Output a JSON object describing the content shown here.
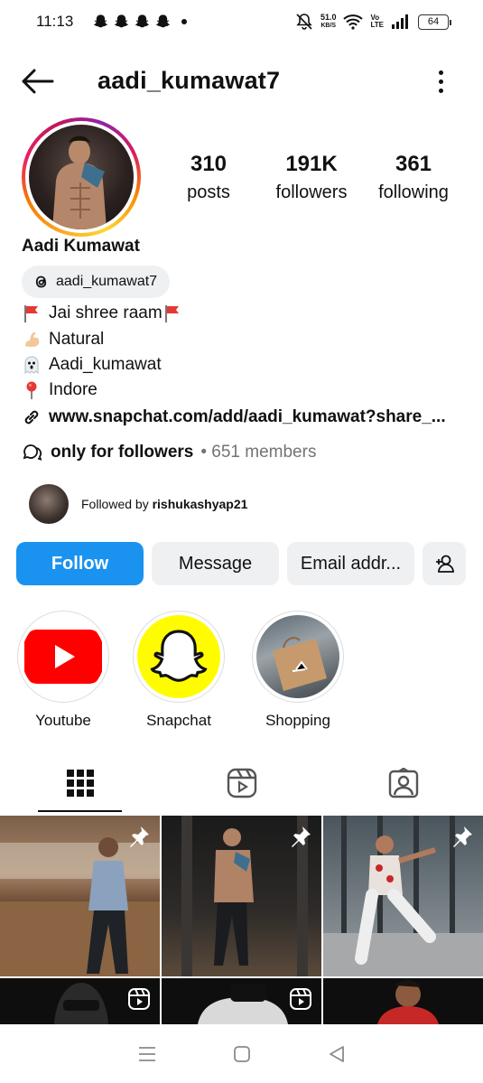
{
  "status_bar": {
    "time": "11:13",
    "net_speed_value": "51.0",
    "net_speed_unit": "KB/S",
    "network_label_top": "Vo",
    "network_label_bottom": "LTE",
    "battery": "64"
  },
  "header": {
    "username": "aadi_kumawat7"
  },
  "stats": {
    "posts_count": "310",
    "posts_label": "posts",
    "followers_count": "191K",
    "followers_label": "followers",
    "following_count": "361",
    "following_label": "following"
  },
  "profile": {
    "display_name": "Aadi Kumawat",
    "threads_handle": "aadi_kumawat7",
    "bio": [
      {
        "emoji": "flag",
        "text": "Jai shree raam"
      },
      {
        "emoji": "flexed-biceps",
        "text": "Natural"
      },
      {
        "emoji": "ghost",
        "text": "Aadi_kumawat"
      },
      {
        "emoji": "round-pushpin",
        "text": "Indore"
      }
    ],
    "link": "www.snapchat.com/add/aadi_kumawat?share_...",
    "channel_name": "only for followers",
    "channel_meta": "• 651 members",
    "followed_by_prefix": "Followed by",
    "followed_by_user": "rishukashyap21"
  },
  "actions": {
    "follow": "Follow",
    "message": "Message",
    "email": "Email addr..."
  },
  "highlights": [
    {
      "label": "Youtube"
    },
    {
      "label": "Snapchat"
    },
    {
      "label": "Shopping"
    }
  ],
  "tabs": [
    "grid-icon",
    "reels-icon",
    "tagged-icon"
  ],
  "colors": {
    "follow_blue": "#1a92ef",
    "youtube_red": "#ff0000",
    "snapchat_yellow": "#fffc00",
    "button_grey": "#eff0f2",
    "meta_grey": "#737373"
  }
}
